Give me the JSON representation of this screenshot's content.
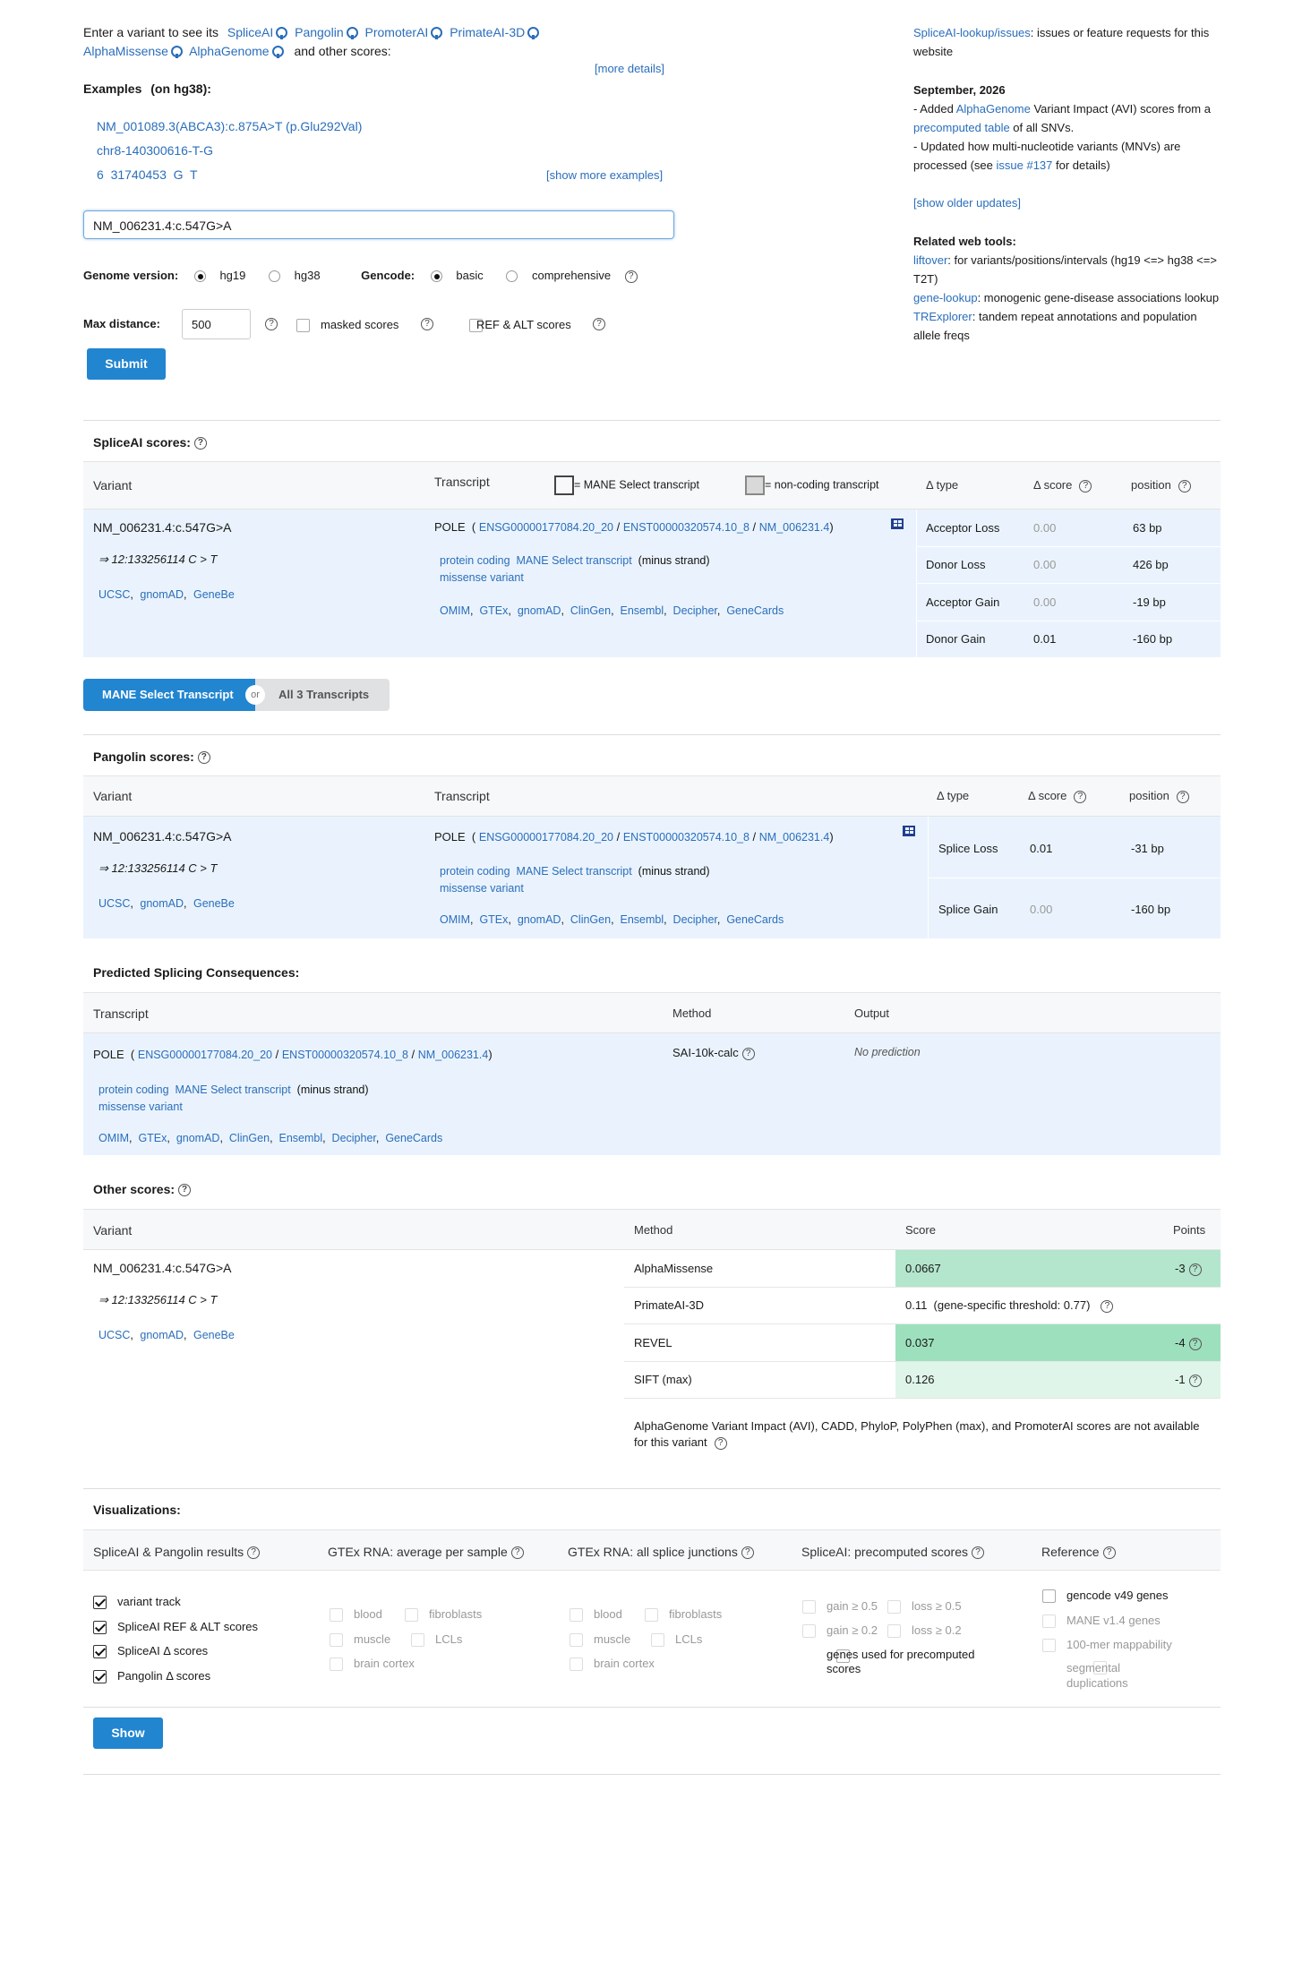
{
  "intro": {
    "prefix": "Enter a variant to see its",
    "tools": [
      "SpliceAI",
      "Pangolin",
      "PromoterAI",
      "PrimateAI-3D",
      "AlphaMissense",
      "AlphaGenome"
    ],
    "suffix": "and other scores:",
    "more_details": "[more details]"
  },
  "examples": {
    "label": "Examples",
    "on": "(on hg38):",
    "items": [
      "NM_001089.3(ABCA3):c.875A>T (p.Glu292Val)",
      "chr8-140300616-T-G",
      "6  31740453  G  T"
    ],
    "show_more": "[show more examples]"
  },
  "search": {
    "value": "NM_006231.4:c.547G>A"
  },
  "form": {
    "genome_label": "Genome version:",
    "hg19": "hg19",
    "hg38": "hg38",
    "gencode_label": "Gencode:",
    "basic": "basic",
    "comprehensive": "comprehensive",
    "maxdist_label": "Max distance:",
    "maxdist_value": "500",
    "masked": "masked scores",
    "refalt": "REF & ALT scores",
    "submit": "Submit"
  },
  "sidebar": {
    "issues_link": "SpliceAI-lookup/issues",
    "issues_text": ": issues or feature requests for this website",
    "date": "September, 2026",
    "u1a": "- Added ",
    "u1link": "AlphaGenome",
    "u1b": " Variant Impact (AVI) scores from a ",
    "u1link2": "precomputed table",
    "u1c": " of all SNVs.",
    "u2a": "- Updated how multi-nucleotide variants (MNVs) are processed (see ",
    "u2link": "issue #137",
    "u2b": " for details)",
    "older": "[show older updates]",
    "related": "Related web tools:",
    "t1": "liftover",
    "t1d": ": for variants/positions/intervals (hg19 <=> hg38 <=> T2T)",
    "t2": "gene-lookup",
    "t2d": ": monogenic gene-disease associations lookup",
    "t3": "TRExplorer",
    "t3d": ": tandem repeat annotations and population allele freqs"
  },
  "variant": {
    "name": "NM_006231.4:c.547G>A",
    "coord": "⇒ 12:133256114 C > T",
    "links": [
      "UCSC",
      "gnomAD",
      "GeneBe"
    ]
  },
  "transcript": {
    "gene": "POLE",
    "ids": [
      "ENSG00000177084.20_20",
      "ENST00000320574.10_8",
      "NM_006231.4"
    ],
    "tags": [
      "protein coding",
      "MANE Select transcript"
    ],
    "strand": "(minus strand)",
    "consequence": "missense variant",
    "links": [
      "OMIM",
      "GTEx",
      "gnomAD",
      "ClinGen",
      "Ensembl",
      "Decipher",
      "GeneCards"
    ]
  },
  "spliceai": {
    "title": "SpliceAI scores:",
    "h_variant": "Variant",
    "h_transcript": "Transcript",
    "legend_mane": "= MANE Select transcript",
    "legend_nc": "= non-coding transcript",
    "h_type": "Δ type",
    "h_score": "Δ score",
    "h_pos": "position",
    "rows": [
      {
        "type": "Acceptor Loss",
        "score": "0.00",
        "pos": "63 bp"
      },
      {
        "type": "Donor Loss",
        "score": "0.00",
        "pos": "426 bp"
      },
      {
        "type": "Acceptor Gain",
        "score": "0.00",
        "pos": "-19 bp"
      },
      {
        "type": "Donor Gain",
        "score": "0.01",
        "pos": "-160 bp"
      }
    ]
  },
  "toggle": {
    "mane": "MANE Select Transcript",
    "or": "or",
    "all": "All 3 Transcripts"
  },
  "pangolin": {
    "title": "Pangolin scores:",
    "h_variant": "Variant",
    "h_transcript": "Transcript",
    "h_type": "Δ type",
    "h_score": "Δ score",
    "h_pos": "position",
    "rows": [
      {
        "type": "Splice Loss",
        "score": "0.01",
        "pos": "-31 bp"
      },
      {
        "type": "Splice Gain",
        "score": "0.00",
        "pos": "-160 bp"
      }
    ]
  },
  "psc": {
    "title": "Predicted Splicing Consequences:",
    "h_transcript": "Transcript",
    "h_method": "Method",
    "h_output": "Output",
    "method": "SAI-10k-calc",
    "output": "No prediction"
  },
  "other": {
    "title": "Other scores:",
    "h_variant": "Variant",
    "h_method": "Method",
    "h_score": "Score",
    "h_points": "Points",
    "rows": [
      {
        "method": "AlphaMissense",
        "score": "0.0667",
        "points": "-3"
      },
      {
        "method": "PrimateAI-3D",
        "score": "0.11  (gene-specific threshold: 0.77)",
        "points": ""
      },
      {
        "method": "REVEL",
        "score": "0.037",
        "points": "-4"
      },
      {
        "method": "SIFT (max)",
        "score": "0.126",
        "points": "-1"
      }
    ],
    "note": "AlphaGenome Variant Impact (AVI), CADD, PhyloP, PolyPhen (max), and PromoterAI scores are not available for this variant"
  },
  "viz": {
    "title": "Visualizations:",
    "h1": "SpliceAI & Pangolin results",
    "h2": "GTEx RNA: average per sample",
    "h3": "GTEx RNA: all splice junctions",
    "h4": "SpliceAI: precomputed scores",
    "h5": "Reference",
    "c1": [
      "variant track",
      "SpliceAI REF & ALT scores",
      "SpliceAI Δ scores",
      "Pangolin Δ scores"
    ],
    "tissues": [
      "blood",
      "fibroblasts",
      "muscle",
      "LCLs",
      "brain cortex"
    ],
    "pre": [
      "gain ≥ 0.5",
      "loss ≥ 0.5",
      "gain ≥ 0.2",
      "loss ≥ 0.2",
      "genes used for precomputed scores"
    ],
    "ref": [
      "gencode v49 genes",
      "MANE v1.4 genes",
      "100-mer mappability",
      "segmental duplications"
    ],
    "show": "Show"
  }
}
